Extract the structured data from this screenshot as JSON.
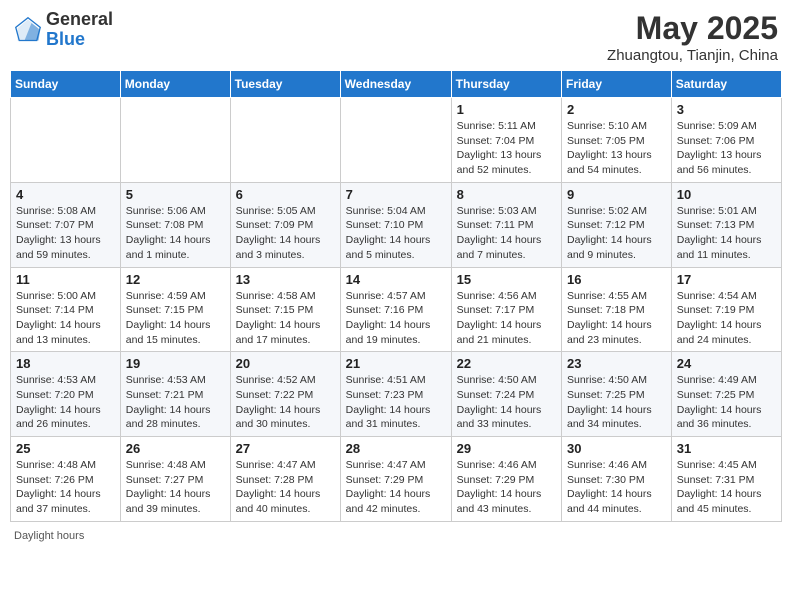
{
  "logo": {
    "general": "General",
    "blue": "Blue"
  },
  "title": {
    "month_year": "May 2025",
    "location": "Zhuangtou, Tianjin, China"
  },
  "weekdays": [
    "Sunday",
    "Monday",
    "Tuesday",
    "Wednesday",
    "Thursday",
    "Friday",
    "Saturday"
  ],
  "weeks": [
    [
      {
        "day": "",
        "info": ""
      },
      {
        "day": "",
        "info": ""
      },
      {
        "day": "",
        "info": ""
      },
      {
        "day": "",
        "info": ""
      },
      {
        "day": "1",
        "info": "Sunrise: 5:11 AM\nSunset: 7:04 PM\nDaylight: 13 hours and 52 minutes."
      },
      {
        "day": "2",
        "info": "Sunrise: 5:10 AM\nSunset: 7:05 PM\nDaylight: 13 hours and 54 minutes."
      },
      {
        "day": "3",
        "info": "Sunrise: 5:09 AM\nSunset: 7:06 PM\nDaylight: 13 hours and 56 minutes."
      }
    ],
    [
      {
        "day": "4",
        "info": "Sunrise: 5:08 AM\nSunset: 7:07 PM\nDaylight: 13 hours and 59 minutes."
      },
      {
        "day": "5",
        "info": "Sunrise: 5:06 AM\nSunset: 7:08 PM\nDaylight: 14 hours and 1 minute."
      },
      {
        "day": "6",
        "info": "Sunrise: 5:05 AM\nSunset: 7:09 PM\nDaylight: 14 hours and 3 minutes."
      },
      {
        "day": "7",
        "info": "Sunrise: 5:04 AM\nSunset: 7:10 PM\nDaylight: 14 hours and 5 minutes."
      },
      {
        "day": "8",
        "info": "Sunrise: 5:03 AM\nSunset: 7:11 PM\nDaylight: 14 hours and 7 minutes."
      },
      {
        "day": "9",
        "info": "Sunrise: 5:02 AM\nSunset: 7:12 PM\nDaylight: 14 hours and 9 minutes."
      },
      {
        "day": "10",
        "info": "Sunrise: 5:01 AM\nSunset: 7:13 PM\nDaylight: 14 hours and 11 minutes."
      }
    ],
    [
      {
        "day": "11",
        "info": "Sunrise: 5:00 AM\nSunset: 7:14 PM\nDaylight: 14 hours and 13 minutes."
      },
      {
        "day": "12",
        "info": "Sunrise: 4:59 AM\nSunset: 7:15 PM\nDaylight: 14 hours and 15 minutes."
      },
      {
        "day": "13",
        "info": "Sunrise: 4:58 AM\nSunset: 7:15 PM\nDaylight: 14 hours and 17 minutes."
      },
      {
        "day": "14",
        "info": "Sunrise: 4:57 AM\nSunset: 7:16 PM\nDaylight: 14 hours and 19 minutes."
      },
      {
        "day": "15",
        "info": "Sunrise: 4:56 AM\nSunset: 7:17 PM\nDaylight: 14 hours and 21 minutes."
      },
      {
        "day": "16",
        "info": "Sunrise: 4:55 AM\nSunset: 7:18 PM\nDaylight: 14 hours and 23 minutes."
      },
      {
        "day": "17",
        "info": "Sunrise: 4:54 AM\nSunset: 7:19 PM\nDaylight: 14 hours and 24 minutes."
      }
    ],
    [
      {
        "day": "18",
        "info": "Sunrise: 4:53 AM\nSunset: 7:20 PM\nDaylight: 14 hours and 26 minutes."
      },
      {
        "day": "19",
        "info": "Sunrise: 4:53 AM\nSunset: 7:21 PM\nDaylight: 14 hours and 28 minutes."
      },
      {
        "day": "20",
        "info": "Sunrise: 4:52 AM\nSunset: 7:22 PM\nDaylight: 14 hours and 30 minutes."
      },
      {
        "day": "21",
        "info": "Sunrise: 4:51 AM\nSunset: 7:23 PM\nDaylight: 14 hours and 31 minutes."
      },
      {
        "day": "22",
        "info": "Sunrise: 4:50 AM\nSunset: 7:24 PM\nDaylight: 14 hours and 33 minutes."
      },
      {
        "day": "23",
        "info": "Sunrise: 4:50 AM\nSunset: 7:25 PM\nDaylight: 14 hours and 34 minutes."
      },
      {
        "day": "24",
        "info": "Sunrise: 4:49 AM\nSunset: 7:25 PM\nDaylight: 14 hours and 36 minutes."
      }
    ],
    [
      {
        "day": "25",
        "info": "Sunrise: 4:48 AM\nSunset: 7:26 PM\nDaylight: 14 hours and 37 minutes."
      },
      {
        "day": "26",
        "info": "Sunrise: 4:48 AM\nSunset: 7:27 PM\nDaylight: 14 hours and 39 minutes."
      },
      {
        "day": "27",
        "info": "Sunrise: 4:47 AM\nSunset: 7:28 PM\nDaylight: 14 hours and 40 minutes."
      },
      {
        "day": "28",
        "info": "Sunrise: 4:47 AM\nSunset: 7:29 PM\nDaylight: 14 hours and 42 minutes."
      },
      {
        "day": "29",
        "info": "Sunrise: 4:46 AM\nSunset: 7:29 PM\nDaylight: 14 hours and 43 minutes."
      },
      {
        "day": "30",
        "info": "Sunrise: 4:46 AM\nSunset: 7:30 PM\nDaylight: 14 hours and 44 minutes."
      },
      {
        "day": "31",
        "info": "Sunrise: 4:45 AM\nSunset: 7:31 PM\nDaylight: 14 hours and 45 minutes."
      }
    ]
  ],
  "footer": {
    "daylight_label": "Daylight hours"
  }
}
